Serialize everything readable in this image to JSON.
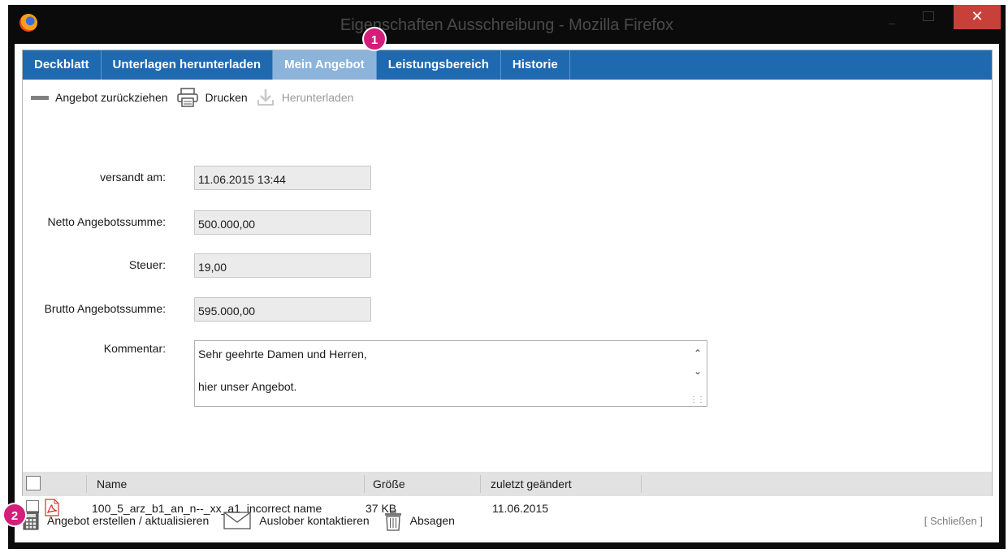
{
  "window": {
    "title": "Eigenschaften Ausschreibung - Mozilla Firefox",
    "close_symbol": "✕"
  },
  "tabs": [
    {
      "label": "Deckblatt",
      "active": false
    },
    {
      "label": "Unterlagen herunterladen",
      "active": false
    },
    {
      "label": "Mein Angebot",
      "active": true
    },
    {
      "label": "Leistungsbereich",
      "active": false
    },
    {
      "label": "Historie",
      "active": false
    }
  ],
  "toolbar": {
    "withdraw_label": "Angebot zurückziehen",
    "print_label": "Drucken",
    "download_label": "Herunterladen"
  },
  "form": {
    "sent_label": "versandt am:",
    "sent_value": "11.06.2015 13:44",
    "net_label": "Netto Angebotssumme:",
    "net_value": "500.000,00",
    "tax_label": "Steuer:",
    "tax_value": "19,00",
    "gross_label": "Brutto Angebotssumme:",
    "gross_value": "595.000,00",
    "comment_label": "Kommentar:",
    "comment_line1": "Sehr geehrte Damen und Herren,",
    "comment_line2": "hier unser Angebot."
  },
  "files": {
    "columns": {
      "name": "Name",
      "size": "Größe",
      "modified": "zuletzt geändert"
    },
    "rows": [
      {
        "name": "100_5_arz_b1_an_n--_xx_a1_incorrect name",
        "size": "37 KB",
        "modified": "11.06.2015",
        "icon": "pdf-icon"
      }
    ]
  },
  "actions": {
    "create_label": "Angebot erstellen / aktualisieren",
    "contact_label": "Auslober kontaktieren",
    "decline_label": "Absagen",
    "close_label": "[ Schließen ]"
  },
  "markers": {
    "m1": "1",
    "m2": "2"
  },
  "colors": {
    "tab_bar": "#1f69b1",
    "tab_active": "#8cb3da",
    "marker": "#d11f7a",
    "close_button": "#c7403a"
  }
}
